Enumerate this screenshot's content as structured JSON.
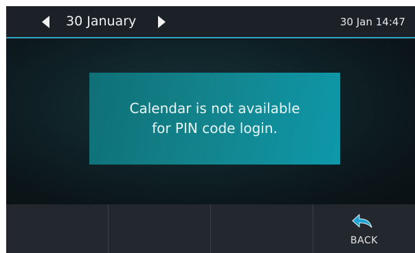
{
  "header": {
    "date_title": "30 January",
    "datetime": "30 Jan 14:47",
    "prev_icon": "arrow-left-icon",
    "next_icon": "arrow-right-icon",
    "accent_color": "#2fa8c8"
  },
  "message": {
    "line1": "Calendar is not available",
    "line2": "for PIN code login."
  },
  "softkeys": [
    {
      "label": ""
    },
    {
      "label": ""
    },
    {
      "label": ""
    },
    {
      "label": "BACK",
      "icon": "back-arrow-icon"
    }
  ]
}
